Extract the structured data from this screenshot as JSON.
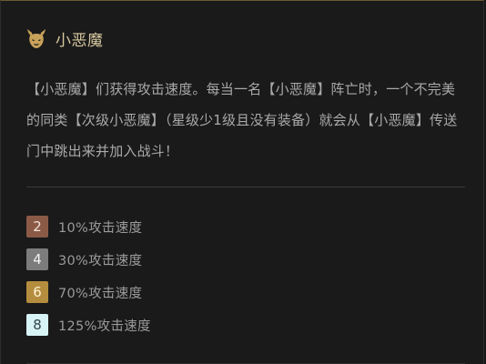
{
  "trait": {
    "name": "小恶魔",
    "icon": "imp-head-icon",
    "icon_color": "#c9a25a"
  },
  "description": "【小恶魔】们获得攻击速度。每当一名【小恶魔】阵亡时，一个不完美的同类【次级小恶魔】（星级少1级且没有装备）就会从【小恶魔】传送门中跳出来并加入战斗！",
  "tiers": [
    {
      "count": "2",
      "effect": "10%攻击速度",
      "color": "#8b5a46"
    },
    {
      "count": "4",
      "effect": "30%攻击速度",
      "color": "#7c7c7c"
    },
    {
      "count": "6",
      "effect": "70%攻击速度",
      "color": "#b48d3e"
    },
    {
      "count": "8",
      "effect": "125%攻击速度",
      "color": "#d7f3f5"
    }
  ]
}
